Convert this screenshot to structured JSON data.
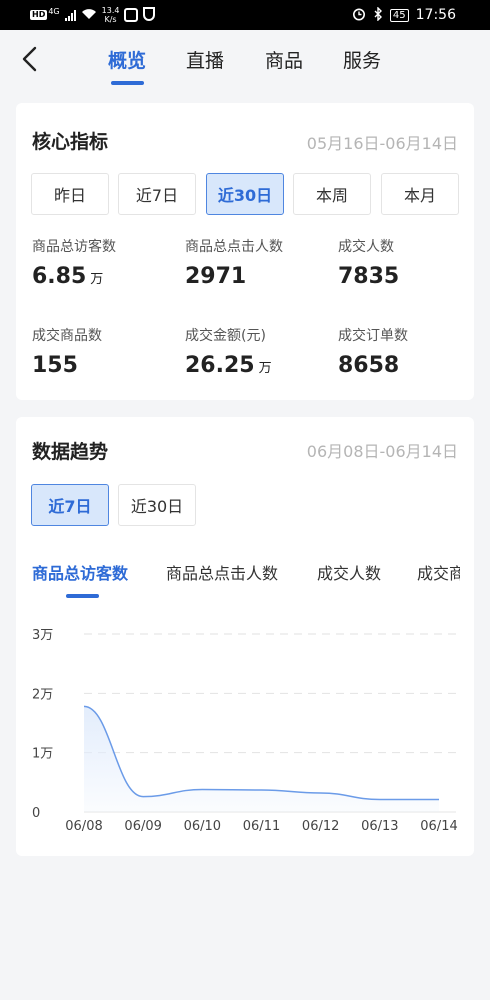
{
  "status_bar": {
    "network_badge": "HD",
    "network_type": "4G",
    "speed_value": "13.4",
    "speed_unit": "K/s",
    "battery": "45",
    "time": "17:56"
  },
  "header": {
    "tabs": [
      {
        "label": "概览",
        "active": true
      },
      {
        "label": "直播",
        "active": false
      },
      {
        "label": "商品",
        "active": false
      },
      {
        "label": "服务",
        "active": false
      }
    ]
  },
  "core": {
    "title": "核心指标",
    "date_range": "05月16日-06月14日",
    "periods": [
      {
        "label": "昨日",
        "selected": false
      },
      {
        "label": "近7日",
        "selected": false
      },
      {
        "label": "近30日",
        "selected": true
      },
      {
        "label": "本周",
        "selected": false
      },
      {
        "label": "本月",
        "selected": false
      }
    ],
    "metrics": [
      {
        "label": "商品总访客数",
        "value": "6.85",
        "unit": "万"
      },
      {
        "label": "商品总点击人数",
        "value": "2971",
        "unit": ""
      },
      {
        "label": "成交人数",
        "value": "7835",
        "unit": ""
      },
      {
        "label": "成交商品数",
        "value": "155",
        "unit": ""
      },
      {
        "label": "成交金额(元)",
        "value": "26.25",
        "unit": "万"
      },
      {
        "label": "成交订单数",
        "value": "8658",
        "unit": ""
      }
    ]
  },
  "trend": {
    "title": "数据趋势",
    "date_range": "06月08日-06月14日",
    "periods": [
      {
        "label": "近7日",
        "selected": true
      },
      {
        "label": "近30日",
        "selected": false
      }
    ],
    "metric_tabs": [
      {
        "label": "商品总访客数",
        "active": true
      },
      {
        "label": "商品总点击人数",
        "active": false
      },
      {
        "label": "成交人数",
        "active": false
      },
      {
        "label": "成交商品数",
        "active": false
      }
    ]
  },
  "chart_data": {
    "type": "area",
    "categories": [
      "06/08",
      "06/09",
      "06/10",
      "06/11",
      "06/12",
      "06/13",
      "06/14"
    ],
    "values": [
      17800,
      2600,
      3800,
      3700,
      3200,
      2100,
      2100
    ],
    "ylim": [
      0,
      30000
    ],
    "y_ticks": [
      "0",
      "1万",
      "2万",
      "3万"
    ],
    "grid": true,
    "line_color": "#6b9be8",
    "fill_color": "#e3edfc"
  },
  "colors": {
    "accent": "#2e6bd6",
    "selected_bg": "#d8e7fb",
    "muted": "#b5b5b5"
  }
}
